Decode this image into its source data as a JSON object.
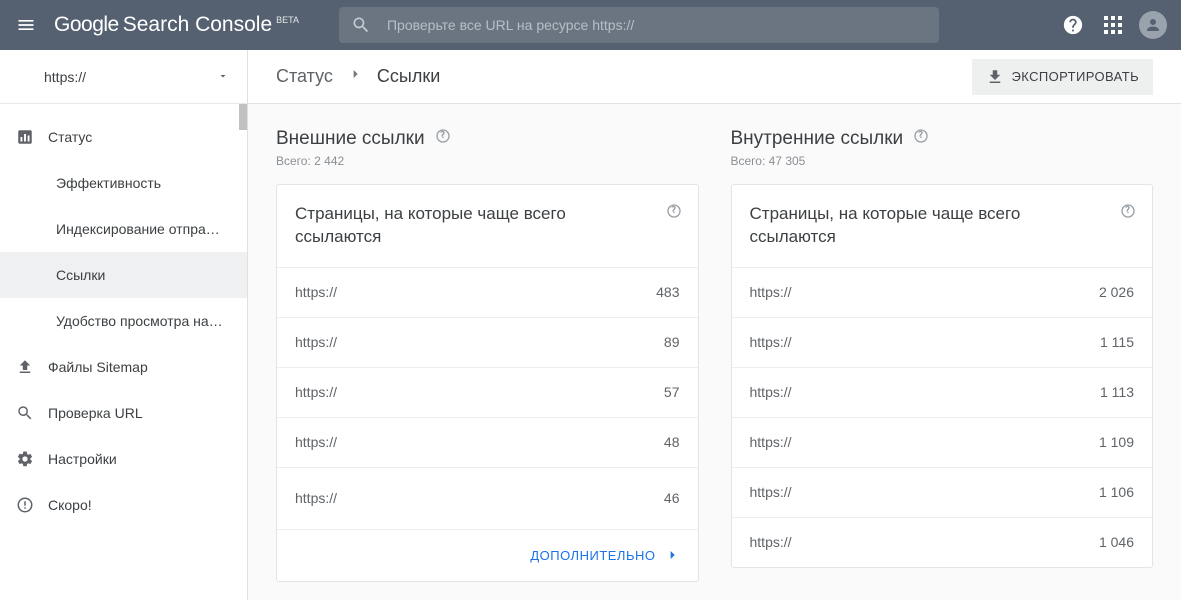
{
  "topbar": {
    "logo_google": "Google",
    "logo_sc": "Search Console",
    "beta": "BETA",
    "search_placeholder": "Проверьте все URL на ресурсе https://"
  },
  "sidebar": {
    "property": "https://",
    "status_label": "Статус",
    "items": [
      {
        "label": "Эффективность"
      },
      {
        "label": "Индексирование отпра…"
      },
      {
        "label": "Ссылки"
      },
      {
        "label": "Удобство просмотра на…"
      }
    ],
    "sitemap": "Файлы Sitemap",
    "inspect": "Проверка URL",
    "settings": "Настройки",
    "soon": "Скоро!"
  },
  "crumbs": {
    "parent": "Статус",
    "current": "Ссылки"
  },
  "export_label": "ЭКСПОРТИРОВАТЬ",
  "external": {
    "title": "Внешние ссылки",
    "total_label": "Всего: 2 442",
    "card_title": "Страницы, на которые чаще всего ссылаются",
    "rows": [
      {
        "url": "https://",
        "count": "483"
      },
      {
        "url": "https://",
        "count": "89"
      },
      {
        "url": "https://",
        "count": "57"
      },
      {
        "url": "https://",
        "count": "48"
      },
      {
        "url": "https://",
        "count": "46"
      }
    ],
    "more": "ДОПОЛНИТЕЛЬНО"
  },
  "internal": {
    "title": "Внутренние ссылки",
    "total_label": "Всего: 47 305",
    "card_title": "Страницы, на которые чаще всего ссылаются",
    "rows": [
      {
        "url": "https://",
        "count": "2 026"
      },
      {
        "url": "https://",
        "count": "1 115"
      },
      {
        "url": "https://",
        "count": "1 113"
      },
      {
        "url": "https://",
        "count": "1 109"
      },
      {
        "url": "https://",
        "count": "1 106"
      },
      {
        "url": "https://",
        "count": "1 046"
      }
    ]
  }
}
